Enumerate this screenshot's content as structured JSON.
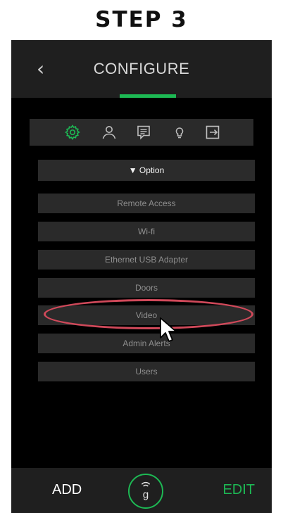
{
  "step_title": "STEP 3",
  "header": {
    "back_icon": "chevron-left-icon",
    "title": "CONFIGURE"
  },
  "colors": {
    "accent": "#1db954",
    "highlight": "#d0495a",
    "background": "#000000",
    "panel": "#1f1f1f"
  },
  "toolbar": {
    "icons": [
      "gear-icon",
      "user-icon",
      "message-icon",
      "lightbulb-icon",
      "logout-icon"
    ],
    "active_icon": "gear-icon"
  },
  "option": {
    "label": "▼ Option"
  },
  "menu": [
    {
      "label": "Remote Access"
    },
    {
      "label": "Wi-fi"
    },
    {
      "label": "Ethernet USB Adapter"
    },
    {
      "label": "Doors"
    },
    {
      "label": "Video"
    },
    {
      "label": "Admin Alerts"
    },
    {
      "label": "Users"
    }
  ],
  "footer": {
    "add_label": "ADD",
    "logo_letter": "g",
    "edit_label": "EDIT"
  }
}
